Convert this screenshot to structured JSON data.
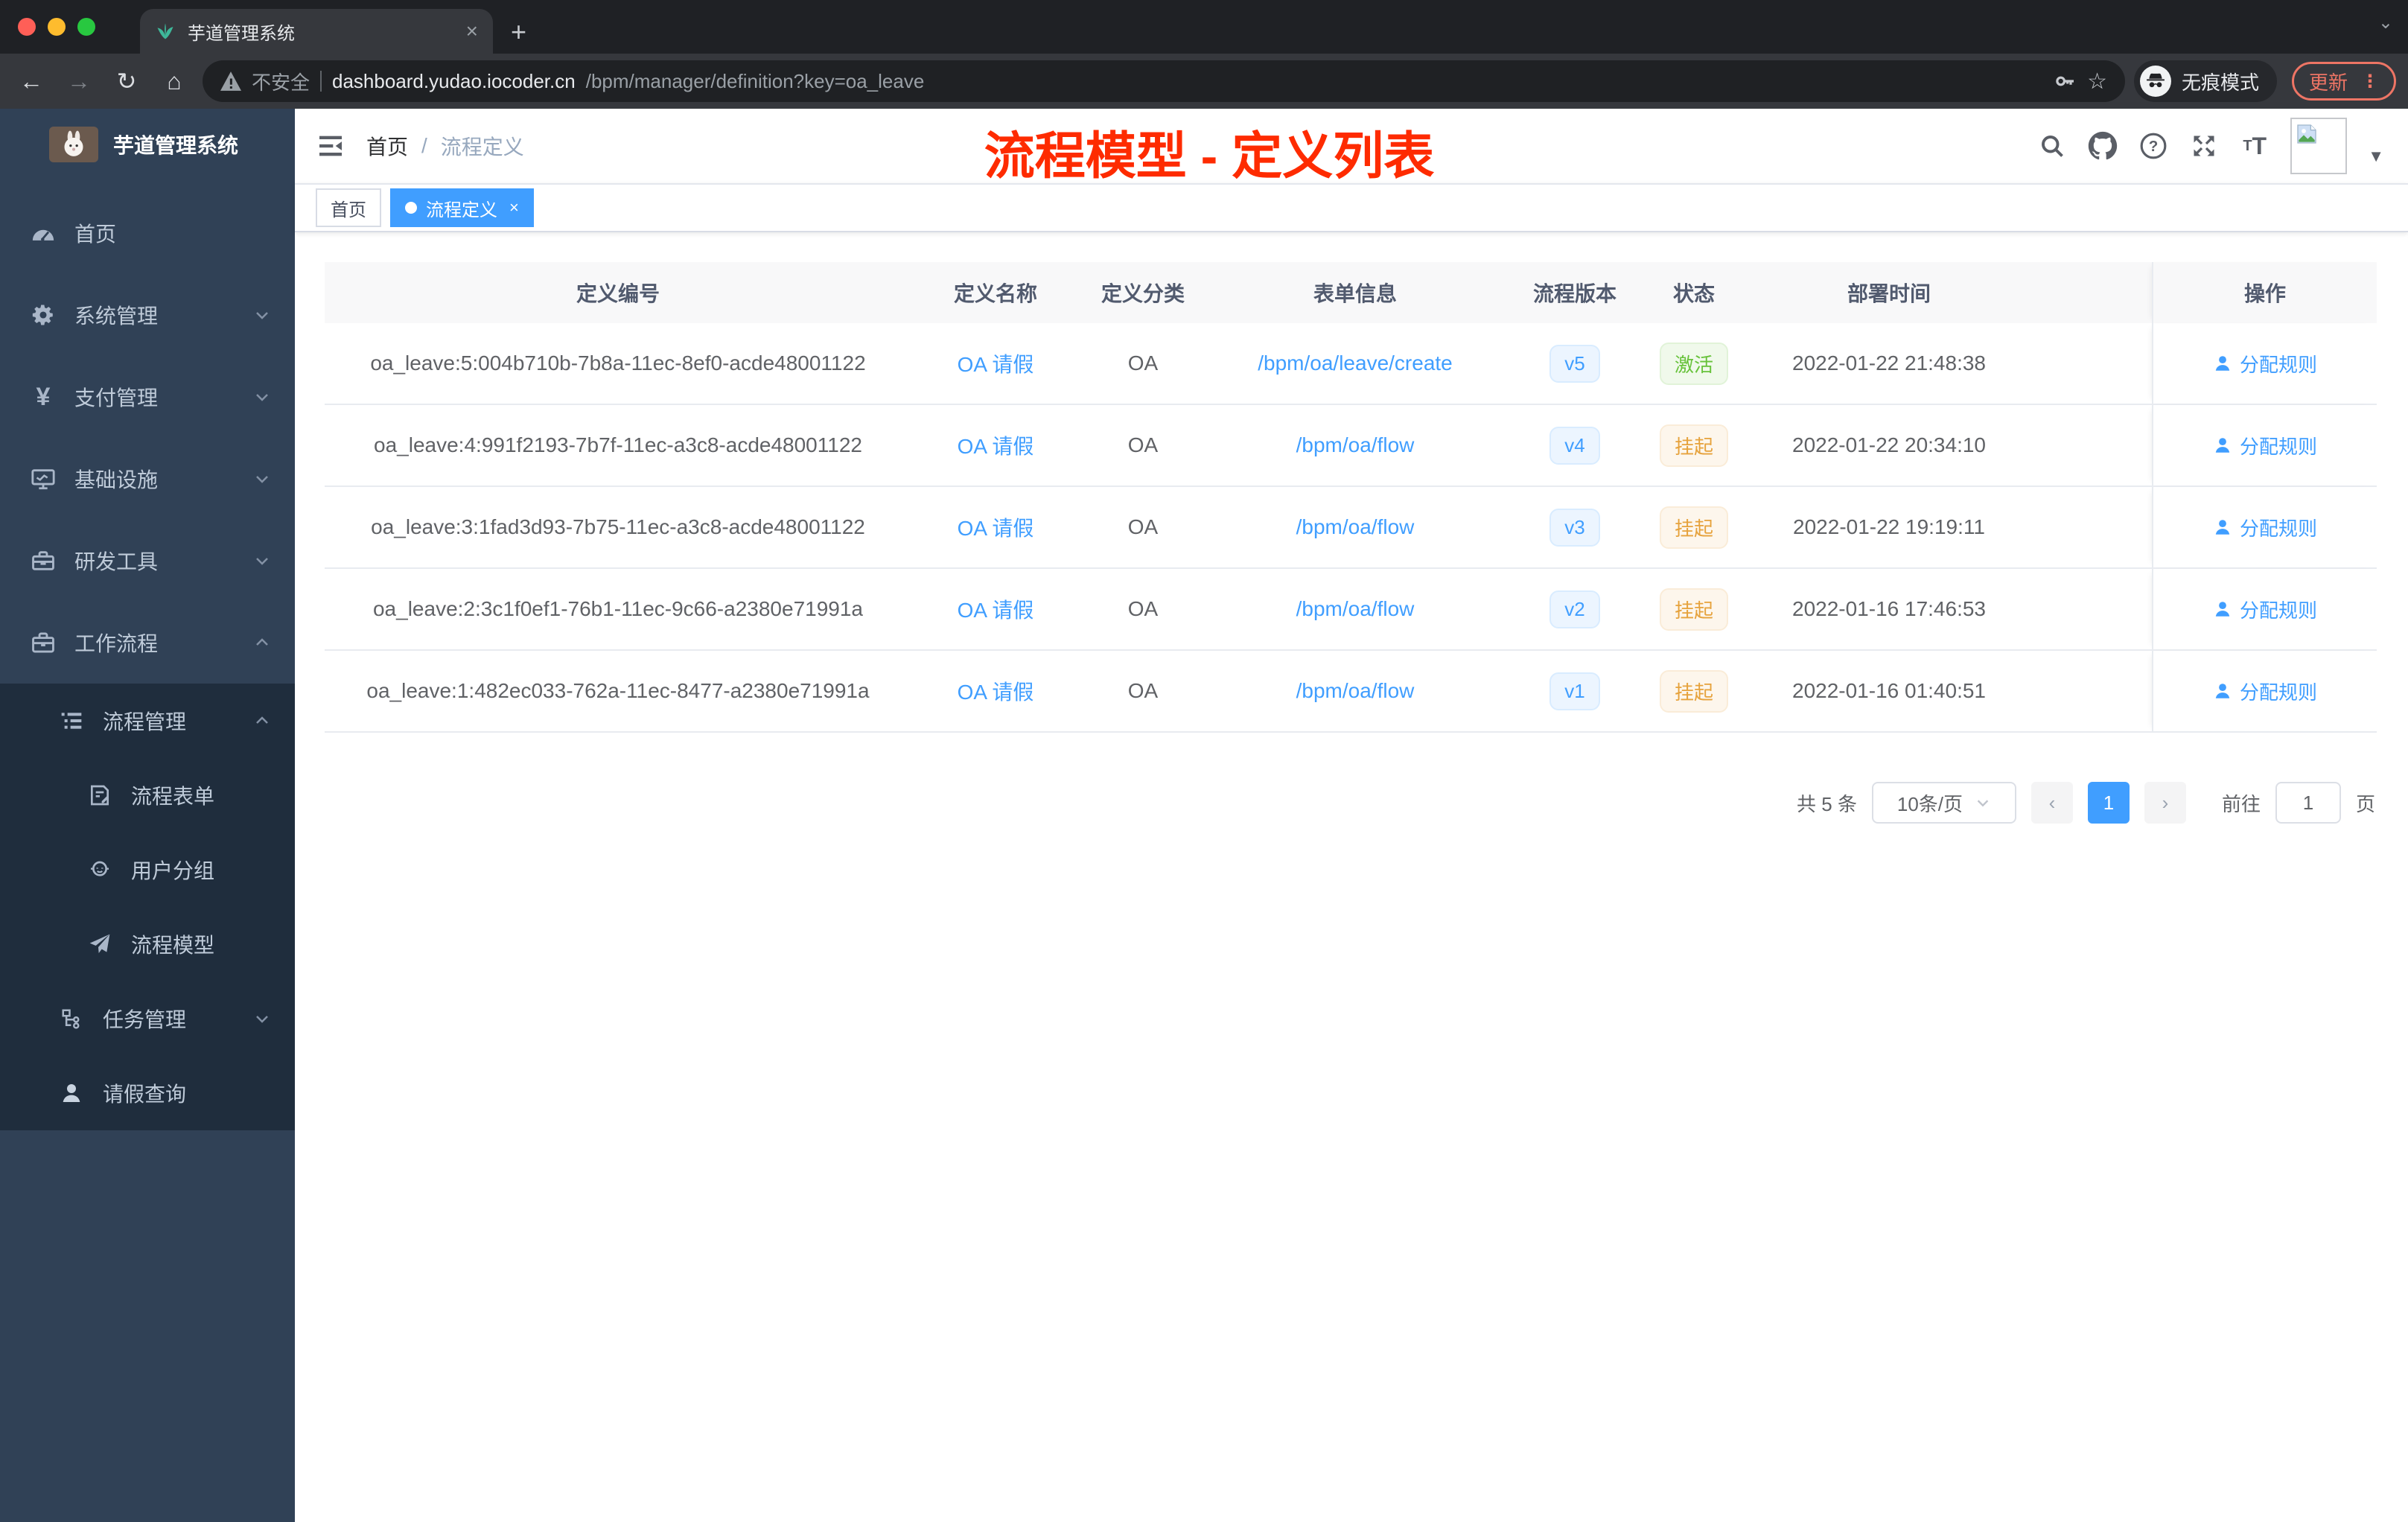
{
  "browser": {
    "tab": {
      "title": "芋道管理系统",
      "close": "×",
      "new_tab": "+"
    },
    "address": {
      "security_label": "不安全",
      "host": "dashboard.yudao.iocoder.cn",
      "path": "/bpm/manager/definition?key=oa_leave"
    },
    "incognito_label": "无痕模式",
    "update_label": "更新"
  },
  "sidebar": {
    "logo_title": "芋道管理系统",
    "items": [
      {
        "label": "首页",
        "icon": "dashboard-icon",
        "level": 1
      },
      {
        "label": "系统管理",
        "icon": "gear-icon",
        "level": 1,
        "state": "collapsed"
      },
      {
        "label": "支付管理",
        "icon": "yen-icon",
        "level": 1,
        "state": "collapsed"
      },
      {
        "label": "基础设施",
        "icon": "monitor-icon",
        "level": 1,
        "state": "collapsed"
      },
      {
        "label": "研发工具",
        "icon": "toolbox-icon",
        "level": 1,
        "state": "collapsed"
      },
      {
        "label": "工作流程",
        "icon": "briefcase-icon",
        "level": 1,
        "state": "expanded"
      },
      {
        "label": "流程管理",
        "icon": "list-tree-icon",
        "level": 2,
        "state": "expanded"
      },
      {
        "label": "流程表单",
        "icon": "form-icon",
        "level": 3
      },
      {
        "label": "用户分组",
        "icon": "user-group-icon",
        "level": 3
      },
      {
        "label": "流程模型",
        "icon": "send-icon",
        "level": 3
      },
      {
        "label": "任务管理",
        "icon": "tree-icon",
        "level": 2,
        "state": "collapsed"
      },
      {
        "label": "请假查询",
        "icon": "user-icon",
        "level": 2
      }
    ]
  },
  "navbar": {
    "breadcrumb": {
      "home": "首页",
      "separator": "/",
      "current": "流程定义"
    },
    "annotation": "流程模型 - 定义列表"
  },
  "tags": {
    "home": "首页",
    "active": "流程定义"
  },
  "table": {
    "columns": [
      "定义编号",
      "定义名称",
      "定义分类",
      "表单信息",
      "流程版本",
      "状态",
      "部署时间",
      "操作"
    ],
    "action_label": "分配规则",
    "rows": [
      {
        "id": "oa_leave:5:004b710b-7b8a-11ec-8ef0-acde48001122",
        "name": "OA 请假",
        "category": "OA",
        "form": "/bpm/oa/leave/create",
        "version": "v5",
        "status": "激活",
        "deploy_time": "2022-01-22 21:48:38"
      },
      {
        "id": "oa_leave:4:991f2193-7b7f-11ec-a3c8-acde48001122",
        "name": "OA 请假",
        "category": "OA",
        "form": "/bpm/oa/flow",
        "version": "v4",
        "status": "挂起",
        "deploy_time": "2022-01-22 20:34:10"
      },
      {
        "id": "oa_leave:3:1fad3d93-7b75-11ec-a3c8-acde48001122",
        "name": "OA 请假",
        "category": "OA",
        "form": "/bpm/oa/flow",
        "version": "v3",
        "status": "挂起",
        "deploy_time": "2022-01-22 19:19:11"
      },
      {
        "id": "oa_leave:2:3c1f0ef1-76b1-11ec-9c66-a2380e71991a",
        "name": "OA 请假",
        "category": "OA",
        "form": "/bpm/oa/flow",
        "version": "v2",
        "status": "挂起",
        "deploy_time": "2022-01-16 17:46:53"
      },
      {
        "id": "oa_leave:1:482ec033-762a-11ec-8477-a2380e71991a",
        "name": "OA 请假",
        "category": "OA",
        "form": "/bpm/oa/flow",
        "version": "v1",
        "status": "挂起",
        "deploy_time": "2022-01-16 01:40:51"
      }
    ]
  },
  "pagination": {
    "total": "共 5 条",
    "page_size": "10条/页",
    "current_page": "1",
    "goto_label": "前往",
    "goto_value": "1",
    "page_unit": "页"
  },
  "colors": {
    "accent_blue": "#409eff",
    "status_green": "#67c23a",
    "status_orange": "#e6a23c",
    "annotation_red": "#fe2b00",
    "sidebar_bg": "#304156",
    "submenu_bg": "#1f2d3d",
    "traffic_lights": [
      "#ff5f57",
      "#febc2e",
      "#28c840"
    ]
  }
}
